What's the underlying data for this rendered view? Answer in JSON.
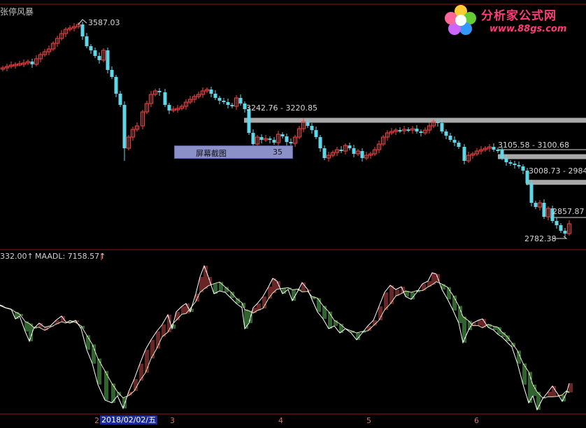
{
  "top_title": "张停风暴",
  "logo": {
    "text": "分析家公式网",
    "url": "www.88gs.com"
  },
  "price_labels": {
    "high": "3587.03",
    "zone1": "3242.76 - 3220.85",
    "zone2": "3105.58 - 3100.68",
    "zone3": "3008.73 - 2984",
    "zone4": "2857.87",
    "low": "2782.38"
  },
  "popup": {
    "label": "屏幕截图",
    "value": "35"
  },
  "indicator": {
    "left_value": "332.00↑",
    "name_value": "MAADL: 7158.57↑"
  },
  "x_axis": {
    "selected_date": "2018/02/02/五",
    "month_marks": [
      "2",
      "3",
      "4",
      "5",
      "6"
    ]
  },
  "colors": {
    "up": "#ff4040",
    "down": "#5fd7e8",
    "zone": "#a8a8a8",
    "divider": "#8b1a1a",
    "line": "#ffffff",
    "ind_up": "#d24a4a",
    "ind_down": "#5ec95e"
  },
  "chart_data": {
    "type": "candlestick+indicator",
    "price_axis_reference": {
      "high": 3587.03,
      "low": 2782.38
    },
    "resistance_zones": [
      [
        3242.76,
        3220.85
      ],
      [
        3105.58,
        3100.68
      ],
      [
        3008.73,
        2984
      ],
      [
        2857.87,
        2857.87
      ]
    ],
    "indicator_name": "MAADL",
    "indicator_last": 7158.57
  }
}
